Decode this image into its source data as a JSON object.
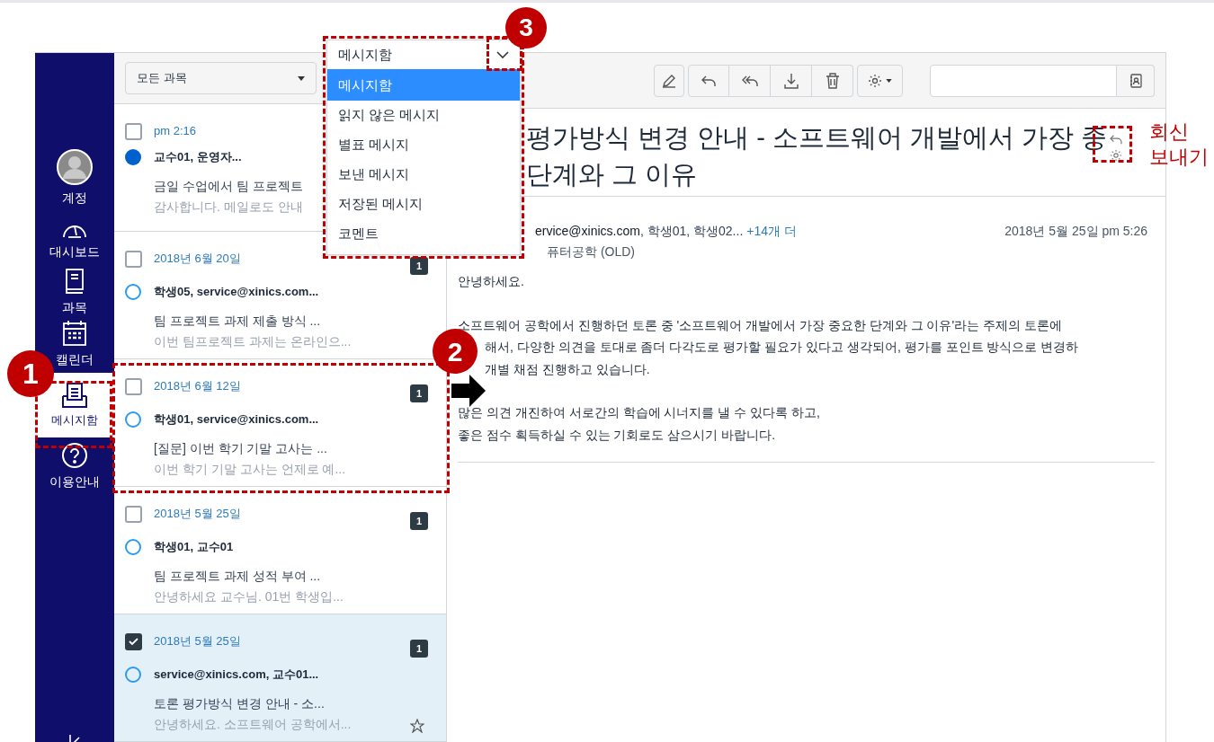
{
  "nav": {
    "items": [
      {
        "kind": "account",
        "label": "계정",
        "selected": false
      },
      {
        "kind": "dashboard",
        "label": "대시보드",
        "selected": false
      },
      {
        "kind": "courses",
        "label": "과목",
        "selected": false
      },
      {
        "kind": "calendar",
        "label": "캘린더",
        "selected": false
      },
      {
        "kind": "inbox",
        "label": "메시지함",
        "selected": true
      },
      {
        "kind": "help",
        "label": "이용안내",
        "selected": false
      }
    ]
  },
  "course_filter": {
    "value": "모든 과목"
  },
  "mailbox_dropdown": {
    "value": "메시지함",
    "options": [
      {
        "label": "메시지함",
        "selected": true
      },
      {
        "label": "읽지 않은 메시지",
        "selected": false
      },
      {
        "label": "별표 메시지",
        "selected": false
      },
      {
        "label": "보낸 메시지",
        "selected": false
      },
      {
        "label": "저장된 메시지",
        "selected": false
      },
      {
        "label": "코멘트",
        "selected": false
      }
    ]
  },
  "conversations": [
    {
      "date": "pm 2:16",
      "sender": "교수01, 운영자...",
      "subject": "금일 수업에서 팀 프로젝트",
      "preview": "감사합니다. 메일로도 안내",
      "unread": true,
      "checked": false,
      "selected": false
    },
    {
      "date": "2018년 6월 20일",
      "sender": "학생05, service@xinics.com...",
      "subject": "팀 프로젝트 과제 제출 방식 ...",
      "preview": "이번 팀프로젝트 과제는 온라인으...",
      "unread": false,
      "checked": false,
      "selected": false,
      "count": "1"
    },
    {
      "date": "2018년 6월 12일",
      "sender": "학생01, service@xinics.com...",
      "subject": "[질문] 이번 학기 기말 고사는 ...",
      "preview": "이번 학기 기말 고사는 언제로 예...",
      "unread": false,
      "checked": false,
      "selected": false,
      "count": "1"
    },
    {
      "date": "2018년 5월 25일",
      "sender": "학생01, 교수01",
      "subject": "팀 프로젝트 과제 성적 부여 ...",
      "preview": "안녕하세요 교수님. 01번 학생입...",
      "unread": false,
      "checked": false,
      "selected": false,
      "count": "1"
    },
    {
      "date": "2018년 5월 25일",
      "sender": "service@xinics.com, 교수01...",
      "subject": "토론 평가방식 변경 안내 - 소...",
      "preview": "안녕하세요. 소프트웨어 공학에서...",
      "unread": false,
      "checked": true,
      "selected": true,
      "count": "1",
      "starred": false
    }
  ],
  "message": {
    "subject_lines": [
      "평가방식 변경 안내 - 소프트웨어 개발에서 가장 중",
      "단계와 그 이유"
    ],
    "sender": "ervice@xinics.com",
    "recipients": ", 학생01, 학생02...",
    "more_link": "+14개 더",
    "course": "퓨터공학 (OLD)",
    "date": "2018년 5월 25일 pm 5:26",
    "body": [
      [
        "안녕하세요."
      ],
      [
        "소프트웨어 공학에서 진행하던 토론 중 '소프트웨어 개발에서 가장 중요한 단계와 그 이유'라는 주제의 토론에",
        "해서, 다양한 의견을 토대로 좀더 다각도로 평가할 필요가 있다고 생각되어, 평가를 포인트 방식으로 변경하",
        "개별 채점 진행하고 있습니다."
      ],
      [
        "많은 의견 개진하여 서로간의 학습에 시너지를 낼 수 있다록 하고,",
        "좋은 점수 획득하실 수 있는 기회로도 삼으시기 바랍니다."
      ]
    ]
  },
  "annotations": {
    "markers": [
      "1",
      "2",
      "3"
    ],
    "reply_label": "회신 보내기"
  }
}
